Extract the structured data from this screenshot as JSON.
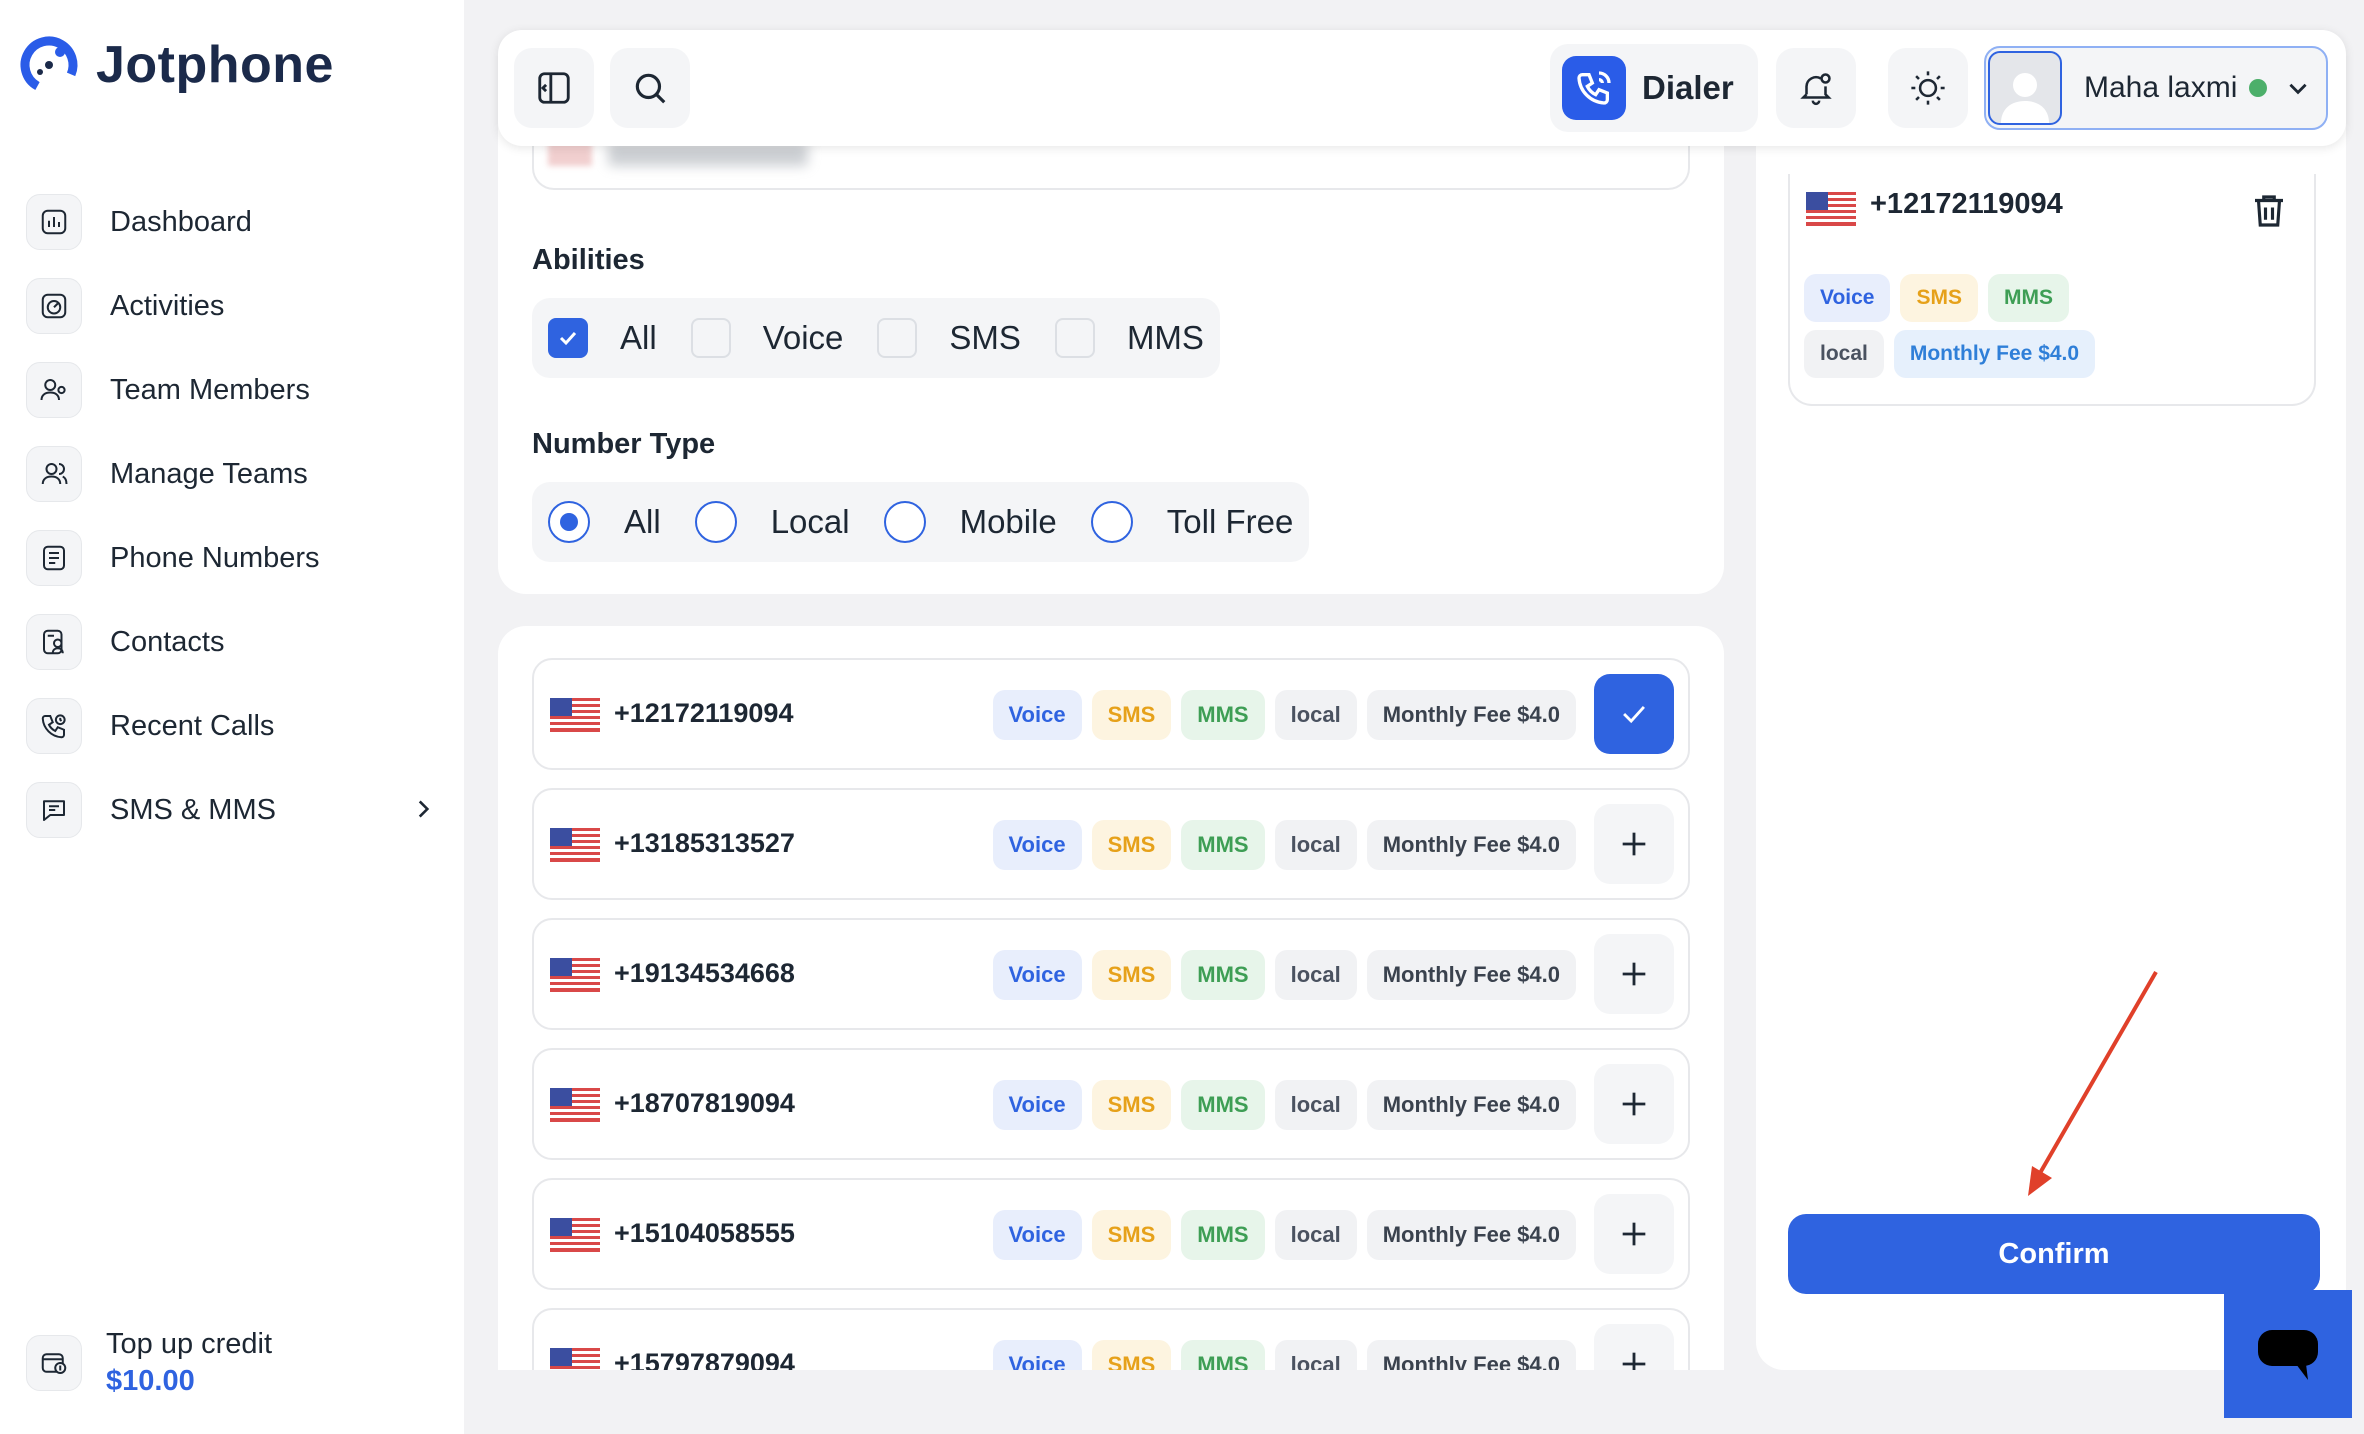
{
  "app": {
    "name": "Jotphone"
  },
  "sidebar": {
    "items": [
      {
        "label": "Dashboard",
        "icon": "dashboard-icon"
      },
      {
        "label": "Activities",
        "icon": "activities-icon"
      },
      {
        "label": "Team Members",
        "icon": "team-members-icon"
      },
      {
        "label": "Manage Teams",
        "icon": "manage-teams-icon"
      },
      {
        "label": "Phone Numbers",
        "icon": "phone-numbers-icon"
      },
      {
        "label": "Contacts",
        "icon": "contacts-icon"
      },
      {
        "label": "Recent Calls",
        "icon": "recent-calls-icon"
      },
      {
        "label": "SMS & MMS",
        "icon": "sms-mms-icon"
      }
    ],
    "topup": {
      "label": "Top up credit",
      "amount": "$10.00"
    }
  },
  "header": {
    "dialer_label": "Dialer",
    "user_name": "Maha laxmi",
    "user_status_color": "#4caf6a"
  },
  "filters": {
    "abilities": {
      "title": "Abilities",
      "options": [
        {
          "label": "All",
          "checked": true
        },
        {
          "label": "Voice",
          "checked": false
        },
        {
          "label": "SMS",
          "checked": false
        },
        {
          "label": "MMS",
          "checked": false
        }
      ]
    },
    "number_type": {
      "title": "Number Type",
      "options": [
        {
          "label": "All",
          "selected": true
        },
        {
          "label": "Local",
          "selected": false
        },
        {
          "label": "Mobile",
          "selected": false
        },
        {
          "label": "Toll Free",
          "selected": false
        }
      ]
    }
  },
  "numbers": [
    {
      "number": "+12172119094",
      "tags": [
        "Voice",
        "SMS",
        "MMS",
        "local",
        "Monthly Fee $4.0"
      ],
      "selected": true
    },
    {
      "number": "+13185313527",
      "tags": [
        "Voice",
        "SMS",
        "MMS",
        "local",
        "Monthly Fee $4.0"
      ],
      "selected": false
    },
    {
      "number": "+19134534668",
      "tags": [
        "Voice",
        "SMS",
        "MMS",
        "local",
        "Monthly Fee $4.0"
      ],
      "selected": false
    },
    {
      "number": "+18707819094",
      "tags": [
        "Voice",
        "SMS",
        "MMS",
        "local",
        "Monthly Fee $4.0"
      ],
      "selected": false
    },
    {
      "number": "+15104058555",
      "tags": [
        "Voice",
        "SMS",
        "MMS",
        "local",
        "Monthly Fee $4.0"
      ],
      "selected": false
    },
    {
      "number": "+15797879094",
      "tags": [
        "Voice",
        "SMS",
        "MMS",
        "local",
        "Monthly Fee $4.0"
      ],
      "selected": false
    }
  ],
  "selected_panel": {
    "number": "+12172119094",
    "tags_row1": [
      "Voice",
      "SMS",
      "MMS"
    ],
    "tags_row2": [
      "local",
      "Monthly Fee $4.0"
    ],
    "confirm_label": "Confirm"
  },
  "colors": {
    "accent": "#2f63e0",
    "annotation_arrow": "#e0402a"
  }
}
